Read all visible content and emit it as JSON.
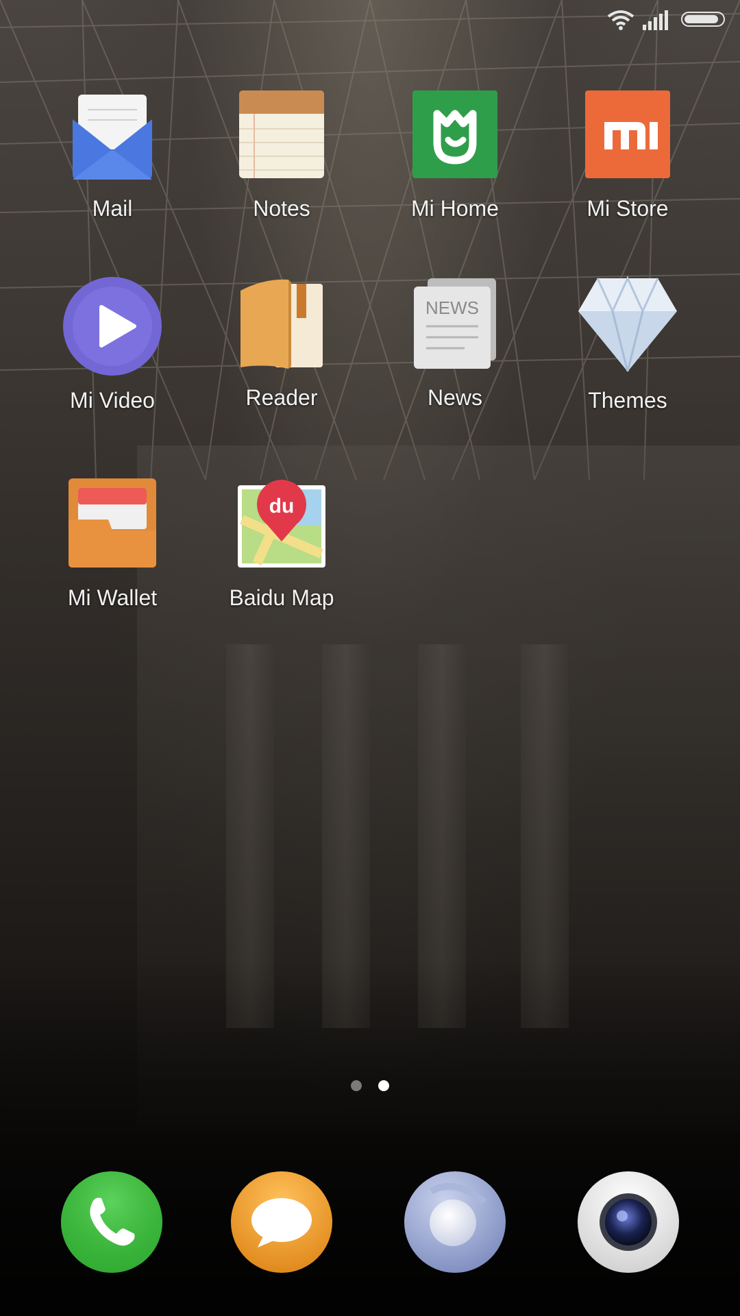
{
  "status_bar": {
    "wifi_icon": "wifi-icon",
    "signal_icon": "cellular-signal-icon",
    "battery_icon": "battery-icon",
    "battery_level_fraction": 0.95
  },
  "apps": [
    {
      "label": "Mail",
      "icon": "mail-icon"
    },
    {
      "label": "Notes",
      "icon": "notes-icon"
    },
    {
      "label": "Mi Home",
      "icon": "mi-home-icon"
    },
    {
      "label": "Mi Store",
      "icon": "mi-store-icon",
      "icon_text": "mi"
    },
    {
      "label": "Mi Video",
      "icon": "mi-video-icon"
    },
    {
      "label": "Reader",
      "icon": "reader-icon"
    },
    {
      "label": "News",
      "icon": "news-icon",
      "icon_text": "NEWS"
    },
    {
      "label": "Themes",
      "icon": "themes-icon"
    },
    {
      "label": "Mi Wallet",
      "icon": "mi-wallet-icon"
    },
    {
      "label": "Baidu Map",
      "icon": "baidu-map-icon",
      "icon_text": "du"
    }
  ],
  "page_indicator": {
    "total": 2,
    "current": 2
  },
  "dock": [
    {
      "name": "phone",
      "icon": "phone-icon"
    },
    {
      "name": "messaging",
      "icon": "message-icon"
    },
    {
      "name": "browser",
      "icon": "browser-icon"
    },
    {
      "name": "camera",
      "icon": "camera-icon"
    }
  ],
  "colors": {
    "mail": "#4a78e0",
    "notes_header": "#c98b52",
    "mi_home": "#2f9e4a",
    "mi_store": "#ec6a3a",
    "mi_video": "#7367d6",
    "reader": "#e8a752",
    "news": "#d8d8d8",
    "themes": "#c8d7ea",
    "mi_wallet": "#e08a3a",
    "baidu_pin": "#e2394a",
    "phone": "#3fbf3f",
    "messaging": "#f0a030",
    "browser": "#9aa8cf",
    "camera": "#e8e8e8",
    "dot_active": "#ffffff",
    "dot_inactive": "#7a7a7a"
  }
}
